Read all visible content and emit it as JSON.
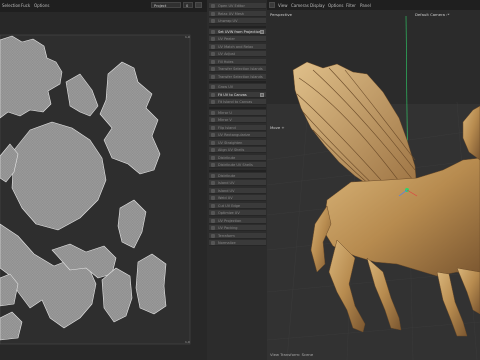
{
  "topbar": {
    "menus": [
      "Selection",
      "Fuck",
      "Options"
    ],
    "dropdown_value": "Project",
    "dropdown2_value": "0"
  },
  "uv_editor": {
    "corner_tl": "1,0",
    "corner_br": "1,0",
    "corner_bl": "0,0"
  },
  "command_panel": {
    "items": [
      {
        "label": "Open UV Editor",
        "bright": false
      },
      {
        "label": "Relax UV Mesh",
        "bright": false
      },
      {
        "label": "Unwrap UV",
        "bright": false
      },
      {
        "label": "Set UVW from Projection",
        "bright": true
      },
      {
        "label": "UV Peeler",
        "bright": false
      },
      {
        "label": "UV Match and Relax",
        "bright": false
      },
      {
        "label": "UV Adjust",
        "bright": false
      },
      {
        "label": "Fill Holes",
        "bright": false
      },
      {
        "label": "Transfer Selection Islands",
        "bright": false
      },
      {
        "label": "Transfer Selection Islands",
        "bright": false
      },
      {
        "label": "Grow UV",
        "bright": false
      },
      {
        "label": "Fit UV to Canvas",
        "bright": true
      },
      {
        "label": "Fit Island to Canvas",
        "bright": false
      },
      {
        "label": "Mirror U",
        "bright": false
      },
      {
        "label": "Mirror V",
        "bright": false
      },
      {
        "label": "Flip Island",
        "bright": false
      },
      {
        "label": "UV Rectangularize",
        "bright": false
      },
      {
        "label": "UV Straighten",
        "bright": false
      },
      {
        "label": "Align UV Shells",
        "bright": false
      },
      {
        "label": "Distribute",
        "bright": false
      },
      {
        "label": "Distribute UV Shells",
        "bright": false
      },
      {
        "label": "Distribute",
        "bright": false
      },
      {
        "label": "Island UV",
        "bright": false
      },
      {
        "label": "Island UV",
        "bright": false
      },
      {
        "label": "Weld UV",
        "bright": false
      },
      {
        "label": "Cut UV Edge",
        "bright": false
      },
      {
        "label": "Optimize UV",
        "bright": false
      },
      {
        "label": "UV Projection",
        "bright": false
      },
      {
        "label": "UV Packing",
        "bright": false
      },
      {
        "label": "Terraform",
        "bright": false
      },
      {
        "label": "Normalize",
        "bright": false
      }
    ]
  },
  "viewport": {
    "menus": [
      "View",
      "Cameras",
      "Display",
      "Options",
      "Filter",
      "Panel"
    ],
    "camera_label": "Perspective",
    "camera_name": "Default Camera :*",
    "move_label": "Move +",
    "footer": "View Transform: Scene"
  }
}
